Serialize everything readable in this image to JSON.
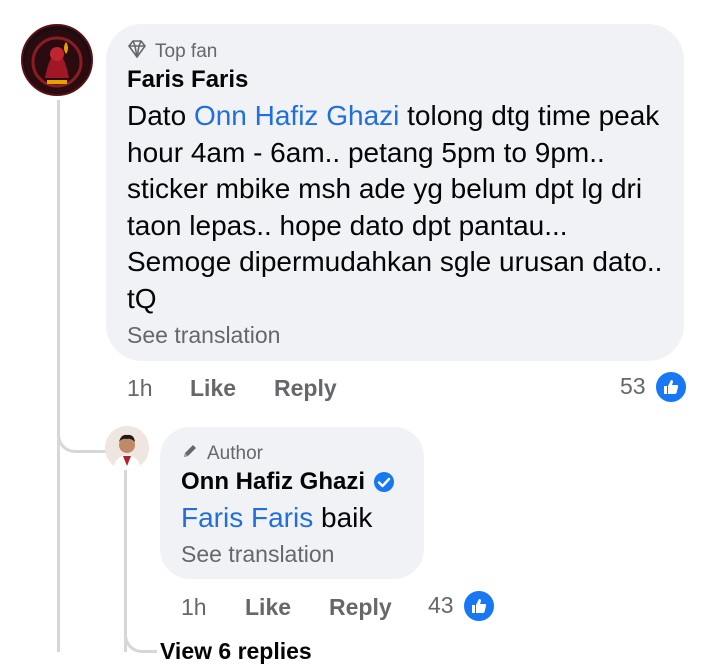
{
  "colors": {
    "mention": "#216fdb",
    "bubble": "#f0f2f5",
    "like": "#1877f2",
    "muted": "#65676b"
  },
  "comment": {
    "badge_icon": "diamond-icon",
    "badge": "Top fan",
    "author": "Faris Faris",
    "text_before": "Dato ",
    "mention": "Onn Hafiz Ghazi",
    "text_after": " tolong dtg time peak hour 4am - 6am.. petang 5pm to 9pm.. sticker mbike msh ade yg belum dpt lg dri taon lepas.. hope dato dpt pantau... Semoge dipermudahkan sgle urusan dato.. tQ",
    "see_translation": "See translation",
    "time": "1h",
    "like_label": "Like",
    "reply_label": "Reply",
    "likes": "53"
  },
  "reply": {
    "badge_icon": "pencil-icon",
    "badge": "Author",
    "author": "Onn Hafiz Ghazi",
    "verified_icon": "verified-icon",
    "mention": "Faris Faris",
    "text_after": " baik",
    "see_translation": "See translation",
    "time": "1h",
    "like_label": "Like",
    "reply_label": "Reply",
    "likes": "43"
  },
  "view_replies": "View 6 replies"
}
